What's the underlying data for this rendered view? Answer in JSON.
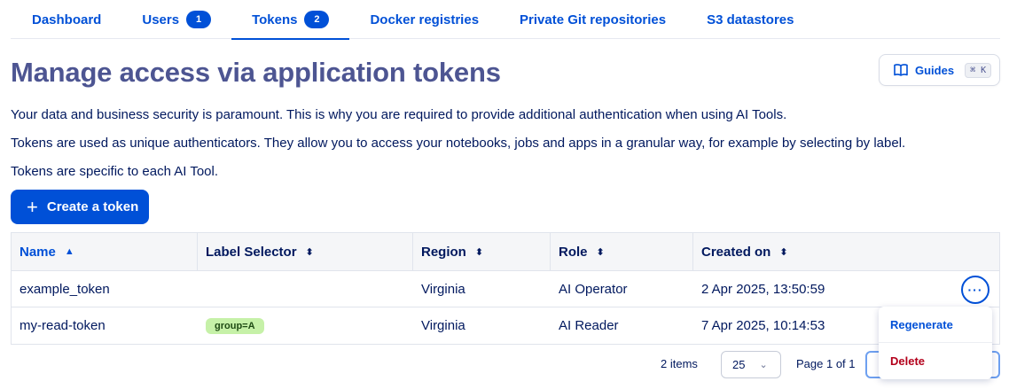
{
  "tabs": [
    {
      "label": "Dashboard",
      "badge": null
    },
    {
      "label": "Users",
      "badge": "1"
    },
    {
      "label": "Tokens",
      "badge": "2"
    },
    {
      "label": "Docker registries",
      "badge": null
    },
    {
      "label": "Private Git repositories",
      "badge": null
    },
    {
      "label": "S3 datastores",
      "badge": null
    }
  ],
  "active_tab": "Tokens",
  "page": {
    "title": "Manage access via application tokens",
    "guides_label": "Guides",
    "guides_shortcut": "⌘ K",
    "paragraphs": [
      "Your data and business security is paramount. This is why you are required to provide additional authentication when using AI Tools.",
      "Tokens are used as unique authenticators. They allow you to access your notebooks, jobs and apps in a granular way, for example by selecting by label.",
      "Tokens are specific to each AI Tool."
    ],
    "create_button_label": "Create a token"
  },
  "table": {
    "columns": [
      "Name",
      "Label Selector",
      "Region",
      "Role",
      "Created on"
    ],
    "sorted_column": "Name",
    "sort_direction": "ascending",
    "rows": [
      {
        "name": "example_token",
        "label_selector": "",
        "region": "Virginia",
        "role": "AI Operator",
        "created_on": "2 Apr 2025, 13:50:59"
      },
      {
        "name": "my-read-token",
        "label_selector": "group=A",
        "region": "Virginia",
        "role": "AI Reader",
        "created_on": "7 Apr 2025, 10:14:53"
      }
    ],
    "row_actions_icon": "more-horizontal-icon"
  },
  "pagination": {
    "items_count": "2 items",
    "page_size": "25",
    "page_info": "Page 1 of 1"
  },
  "action_menu": {
    "items": [
      "Regenerate",
      "Delete"
    ]
  },
  "colors": {
    "primary": "#0050d7",
    "title": "#4d5592",
    "text": "#00185e",
    "danger": "#b3001b",
    "chip_bg": "#c6f1a8"
  }
}
